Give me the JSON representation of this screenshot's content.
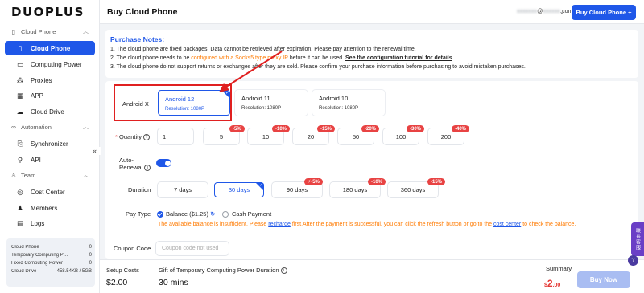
{
  "brand": {
    "logo": "DUOPLUS"
  },
  "sidebar": {
    "groups": [
      {
        "label": "Cloud Phone",
        "icon": "phone-group-icon"
      },
      {
        "label": "Automation",
        "icon": "infinity-icon"
      },
      {
        "label": "Team",
        "icon": "team-icon"
      }
    ],
    "items": [
      {
        "label": "Cloud Phone",
        "icon": "phone-icon"
      },
      {
        "label": "Computing Power",
        "icon": "monitor-icon"
      },
      {
        "label": "Proxies",
        "icon": "proxy-icon"
      },
      {
        "label": "APP",
        "icon": "apps-grid-icon"
      },
      {
        "label": "Cloud Drive",
        "icon": "cloud-icon"
      },
      {
        "label": "Synchronizer",
        "icon": "sync-icon"
      },
      {
        "label": "API",
        "icon": "api-icon"
      },
      {
        "label": "Cost Center",
        "icon": "cost-icon"
      },
      {
        "label": "Members",
        "icon": "members-icon"
      },
      {
        "label": "Logs",
        "icon": "logs-icon"
      }
    ],
    "collapse_glyph": "«",
    "stats": [
      {
        "label": "Cloud Phone",
        "value": "0"
      },
      {
        "label": "Temporary Computing Po...",
        "value": "0"
      },
      {
        "label": "Fixed Computing Power",
        "value": "0"
      },
      {
        "label": "Cloud Drive",
        "value": "458.54KB / 5GB"
      }
    ]
  },
  "header": {
    "title": "Buy Cloud Phone",
    "user_email_visible": "@",
    "user_email_suffix": ".com",
    "buy_button": "Buy Cloud Phone +"
  },
  "notes": {
    "title": "Purchase Notes:",
    "line1": "1. The cloud phone are fixed packages. Data cannot be retrieved after expiration. Please pay attention to the renewal time.",
    "line2_pre": "2. The cloud phone needs to be ",
    "line2_highlight": "configured with a Socks5 type proxy IP",
    "line2_mid": " before it can be used. ",
    "line2_link": "See the configuration tutorial for details",
    "line2_end": ".",
    "line3": "3. The cloud phone do not support returns or exchanges after they are sold. Please confirm your purchase information before purchasing to avoid mistaken purchases."
  },
  "form": {
    "android_label": "Android X",
    "os_options": [
      {
        "name": "Android 12",
        "resolution": "Resolution:  1080P",
        "selected": true
      },
      {
        "name": "Android 11",
        "resolution": "Resolution:  1080P",
        "selected": false
      },
      {
        "name": "Android 10",
        "resolution": "Resolution:  1080P",
        "selected": false
      }
    ],
    "quantity_label": "Quantity",
    "quantity_value": "1",
    "quantities": [
      {
        "value": "5",
        "discount": "-5%"
      },
      {
        "value": "10",
        "discount": "-10%"
      },
      {
        "value": "20",
        "discount": "-15%"
      },
      {
        "value": "50",
        "discount": "-20%"
      },
      {
        "value": "100",
        "discount": "-30%"
      },
      {
        "value": "200",
        "discount": "-40%"
      }
    ],
    "auto_renewal_label_1": "Auto-",
    "auto_renewal_label_2": "Renewal",
    "auto_renewal_on": true,
    "duration_label": "Duration",
    "durations": [
      {
        "label": "7 days",
        "discount": ""
      },
      {
        "label": "30 days",
        "discount": ""
      },
      {
        "label": "90 days",
        "discount": "⚡-5%"
      },
      {
        "label": "180 days",
        "discount": "-10%"
      },
      {
        "label": "360 days",
        "discount": "-15%"
      }
    ],
    "selected_duration": "30 days",
    "pay_type_label": "Pay Type",
    "pay_balance": "Balance ($1.25)",
    "pay_cash": "Cash Payment",
    "warning_pre": "The available balance is insufficient. Please ",
    "warning_link1": "recharge",
    "warning_mid": " first.After the payment is successful, you can click the refresh button or go to the ",
    "warning_link2": "cost center",
    "warning_end": " to check the balance.",
    "coupon_label": "Coupon Code",
    "coupon_placeholder": "Coupon code not used"
  },
  "footer": {
    "setup_costs_label": "Setup Costs",
    "setup_costs_value": "$2.00",
    "gift_label": "Gift of Temporary Computing Power Duration",
    "gift_value": "30 mins",
    "summary_label": "Summary",
    "summary_currency": "$",
    "summary_int": "2",
    "summary_dec": ".00",
    "buy_now": "Buy Now"
  },
  "floating": {
    "tab_text": "联系客服",
    "help_glyph": "?"
  },
  "colors": {
    "accent": "#1f57e8",
    "warning": "#ff7a00",
    "discount": "#e84343",
    "highlight_box": "#e02020"
  }
}
